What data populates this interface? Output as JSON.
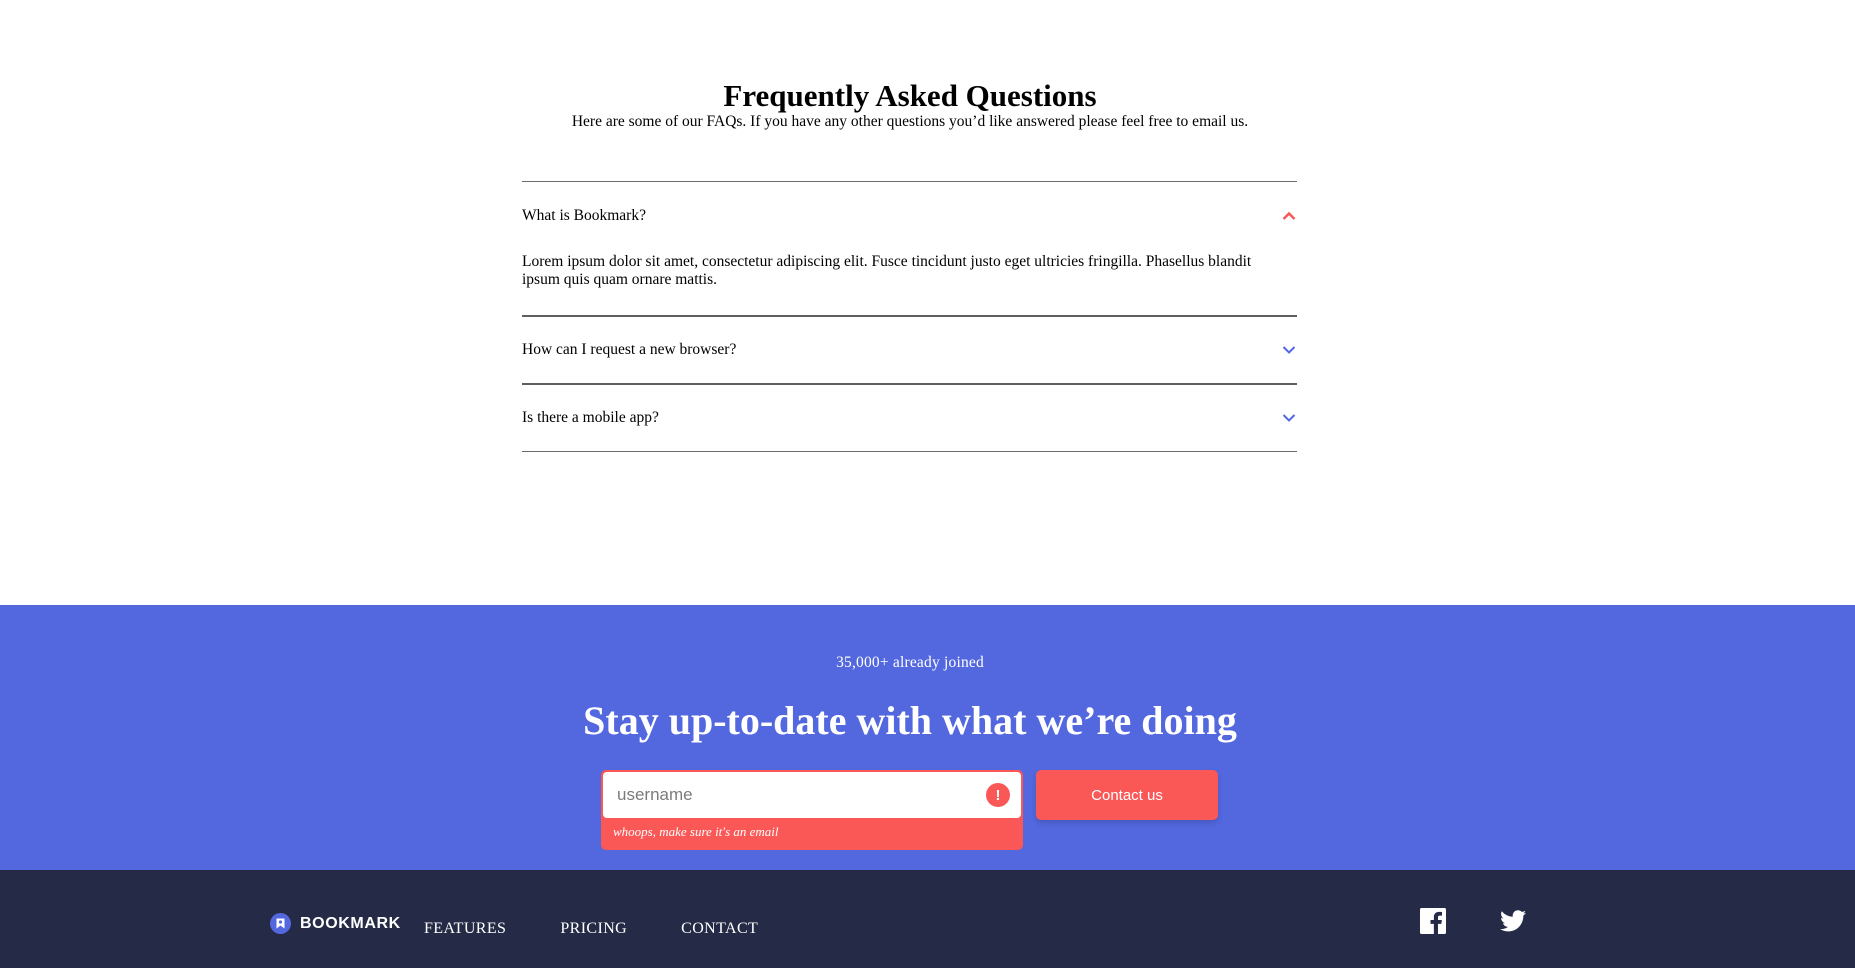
{
  "faq": {
    "title": "Frequently Asked Questions",
    "subtitle": "Here are some of our FAQs. If you have any other questions you’d like answered please feel free to email us.",
    "items": [
      {
        "question": "What is Bookmark?",
        "answer": "Lorem ipsum dolor sit amet, consectetur adipiscing elit. Fusce tincidunt justo eget ultricies fringilla. Phasellus blandit ipsum quis quam ornare mattis.",
        "open": true
      },
      {
        "question": "How can I request a new browser?",
        "open": false
      },
      {
        "question": "Is there a mobile app?",
        "open": false
      }
    ],
    "colors": {
      "open_chevron": "#fa5757",
      "closed_chevron": "#5368df"
    }
  },
  "newsletter": {
    "joined": "35,000+ already joined",
    "title": "Stay up-to-date with what we’re doing",
    "email_placeholder": "username",
    "error_message": "whoops, make sure it's an email",
    "error_icon": "!",
    "button_label": "Contact us",
    "colors": {
      "background": "#5368df",
      "accent": "#fa5757"
    }
  },
  "footer": {
    "logo_text": "BOOKMARK",
    "nav": [
      "FEATURES",
      "PRICING",
      "CONTACT"
    ],
    "social": [
      "facebook-icon",
      "twitter-icon"
    ],
    "colors": {
      "background": "#252b46"
    }
  }
}
